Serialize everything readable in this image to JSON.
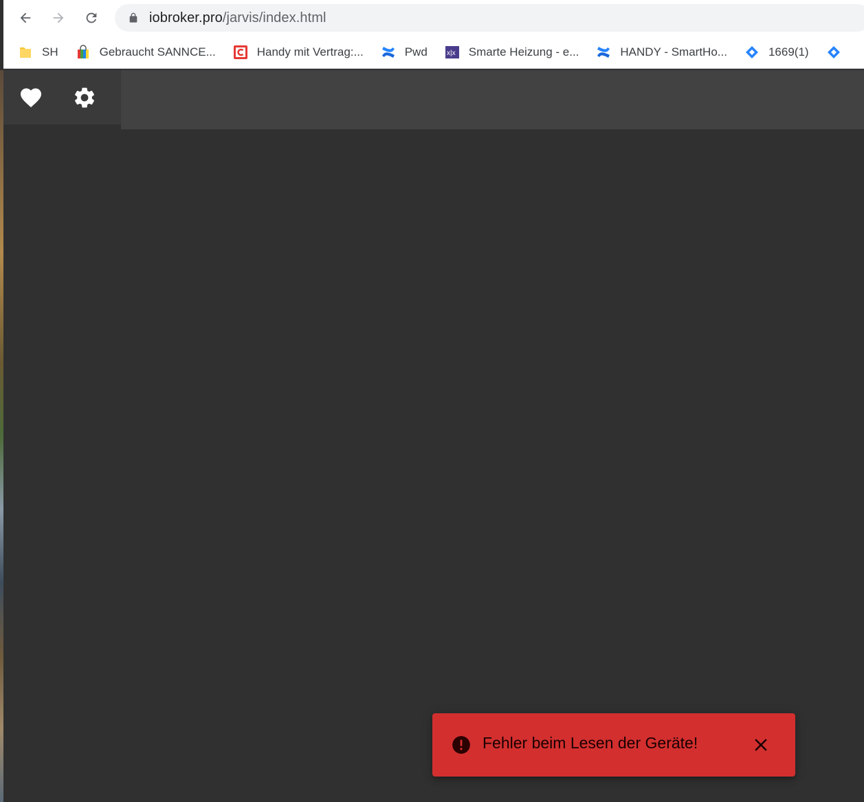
{
  "browser": {
    "url_host": "iobroker.pro",
    "url_path": "/jarvis/index.html",
    "bookmarks": [
      {
        "label": "SH",
        "icon": "folder-icon"
      },
      {
        "label": "Gebraucht SANNCE...",
        "icon": "shopping-bag-icon"
      },
      {
        "label": "Handy mit Vertrag:...",
        "icon": "c-logo-icon"
      },
      {
        "label": "Pwd",
        "icon": "confluence-icon"
      },
      {
        "label": "Smarte Heizung - e...",
        "icon": "xx-logo-icon"
      },
      {
        "label": "HANDY - SmartHo...",
        "icon": "confluence-icon"
      },
      {
        "label": "1669(1)",
        "icon": "jira-icon"
      },
      {
        "label": "",
        "icon": "jira-icon"
      }
    ]
  },
  "app": {
    "tabs": [
      {
        "name": "favorites",
        "icon": "heart-icon"
      },
      {
        "name": "settings",
        "icon": "gear-icon"
      }
    ]
  },
  "snackbar": {
    "message": "Fehler beim Lesen der Geräte!",
    "icon": "error-icon",
    "close_icon": "close-icon",
    "color": "#d32f2f"
  },
  "colors": {
    "appbar": "#424242",
    "background": "#303030"
  }
}
